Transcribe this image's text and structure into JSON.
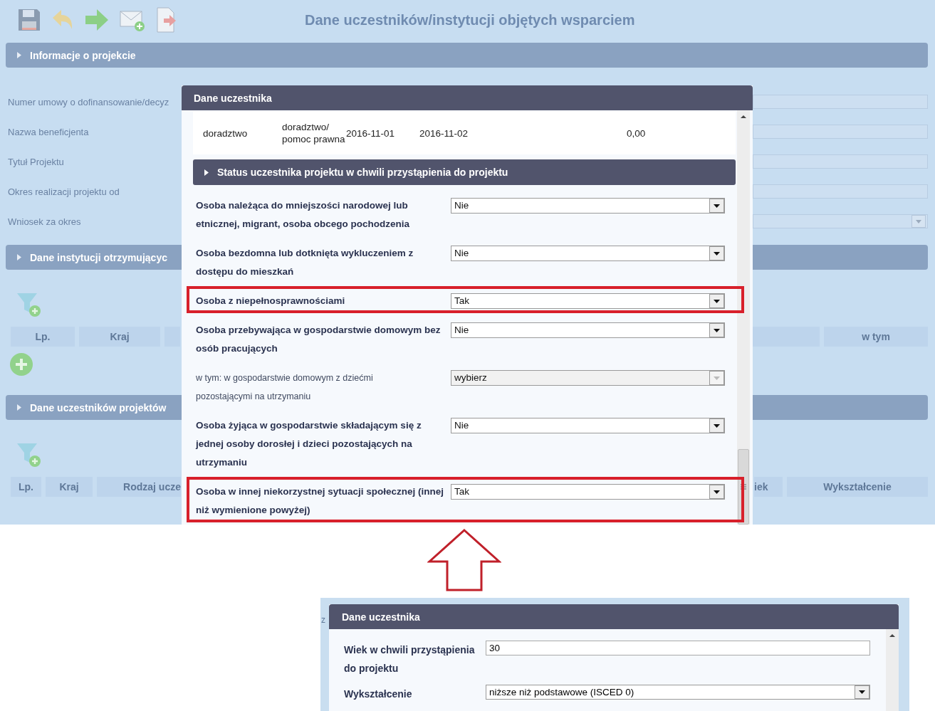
{
  "screen": {
    "title": "Dane uczestników/instytucji objętych wsparciem",
    "sections": [
      {
        "title": "Informacje o projekcie",
        "expanded": false
      },
      {
        "title": "Dane instytucji otrzymującyc",
        "expanded": false
      },
      {
        "title": "Dane uczestników projektów",
        "expanded": false
      }
    ],
    "project_fields": [
      {
        "label": "Numer umowy o dofinansowanie/decyz",
        "kind": "text"
      },
      {
        "label": "Nazwa beneficjenta",
        "kind": "text"
      },
      {
        "label": "Tytuł Projektu",
        "kind": "text"
      },
      {
        "label": "Okres realizacji projektu od",
        "kind": "text"
      },
      {
        "label": "Wniosek za okres",
        "kind": "select"
      }
    ],
    "institutions_table": {
      "left_columns": [
        "Lp.",
        "Kraj",
        ""
      ],
      "right_columns": [
        "",
        "w tym"
      ]
    },
    "participants_table": {
      "left_columns": [
        "Lp.",
        "Kraj",
        "Rodzaj ucze"
      ],
      "right_columns": [
        "iek",
        "Wykształcenie"
      ]
    }
  },
  "modal": {
    "title": "Dane uczestnika",
    "support_row": [
      "doradztwo",
      "doradztwo/ pomoc prawna",
      "2016-11-01",
      "2016-11-02",
      "0,00"
    ],
    "subsection": {
      "title": "Status uczestnika projektu w chwili przystąpienia do projektu",
      "expanded": false
    },
    "fields": [
      {
        "label": "Osoba należąca do mniejszości narodowej lub etnicznej, migrant, osoba obcego pochodzenia",
        "value": "Nie",
        "disabled": false,
        "highlighted": false
      },
      {
        "label": "Osoba bezdomna lub dotknięta wykluczeniem z dostępu do mieszkań",
        "value": "Nie",
        "disabled": false,
        "highlighted": false
      },
      {
        "label": "Osoba z niepełnosprawnościami",
        "value": "Tak",
        "disabled": false,
        "highlighted": true
      },
      {
        "label": "Osoba przebywająca w gospodarstwie domowym bez osób pracujących",
        "value": "Nie",
        "disabled": false,
        "highlighted": false
      },
      {
        "label": "w tym: w gospodarstwie domowym z dziećmi pozostającymi na utrzymaniu",
        "value": "wybierz",
        "disabled": true,
        "highlighted": false
      },
      {
        "label": "Osoba żyjąca w gospodarstwie składającym się z jednej osoby dorosłej i dzieci pozostających na utrzymaniu",
        "value": "Nie",
        "disabled": false,
        "highlighted": false
      },
      {
        "label": "Osoba w innej niekorzystnej sytuacji społecznej (innej niż wymienione powyżej)",
        "value": "Tak",
        "disabled": false,
        "highlighted": true
      }
    ]
  },
  "detail_view": {
    "fragment": "z",
    "title": "Dane uczestnika",
    "fields": [
      {
        "label": "Wiek w chwili przystąpienia do projektu",
        "value": "30",
        "kind": "text"
      },
      {
        "label": "Wykształcenie",
        "value": "niższe niż podstawowe (ISCED 0)",
        "kind": "select"
      }
    ]
  }
}
